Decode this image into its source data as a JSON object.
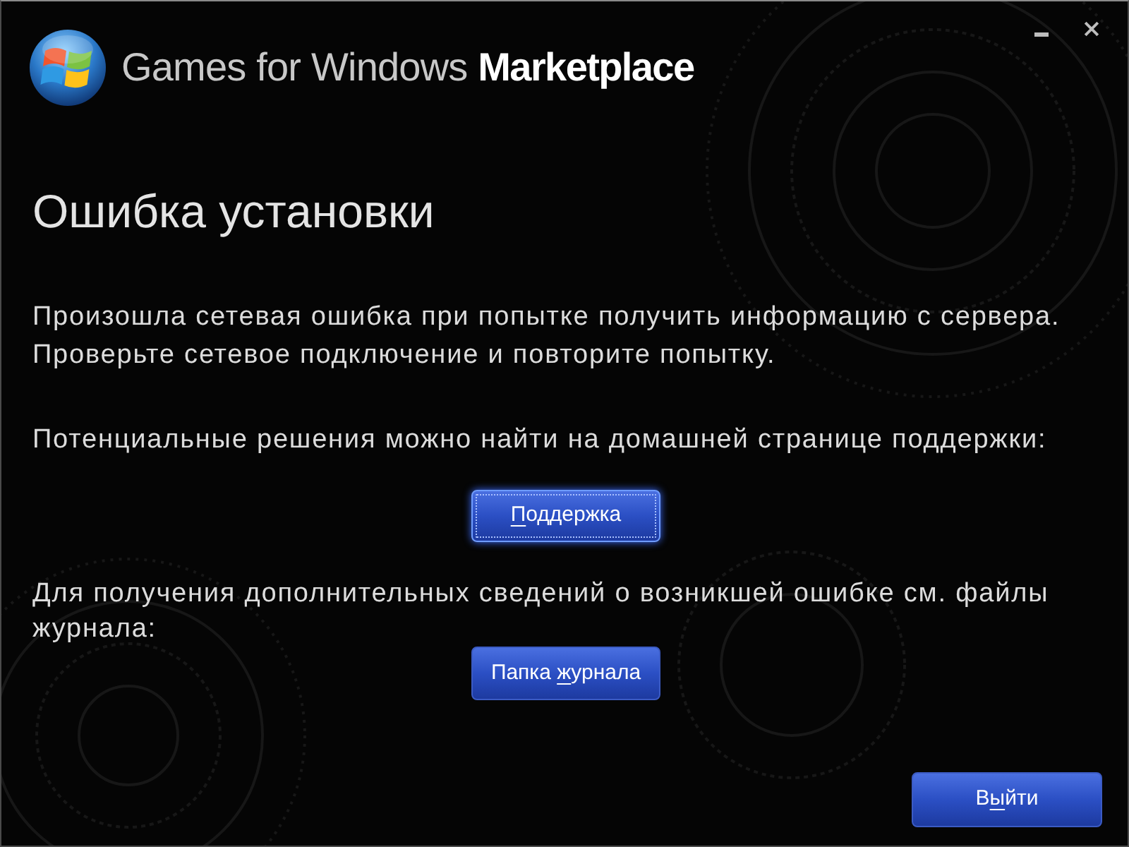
{
  "header": {
    "title": "Games for Windows **Marketplace**"
  },
  "heading": "Ошибка установки",
  "message": {
    "lines": [
      "Произошла сетевая ошибка при попытке получить информацию с сервера.",
      "Проверьте сетевое подключение и повторите попытку."
    ]
  },
  "support": {
    "text": "Потенциальные решения можно найти на домашней странице поддержки:",
    "button": {
      "focused": true,
      "label": [
        {
          "text": "П",
          "underlined": true
        },
        {
          "text": "оддержка",
          "underlined": false
        }
      ]
    }
  },
  "logs": {
    "text": "Для получения дополнительных сведений о возникшей ошибке см. файлы журнала:",
    "button": {
      "focused": false,
      "label": [
        {
          "text": "Папка ",
          "underlined": false
        },
        {
          "text": "ж",
          "underlined": true
        },
        {
          "text": "урнала",
          "underlined": false
        }
      ]
    }
  },
  "exit_button": {
    "focused": false,
    "label": [
      {
        "text": "В",
        "underlined": false
      },
      {
        "text": "ы",
        "underlined": true
      },
      {
        "text": "йти",
        "underlined": false
      }
    ]
  }
}
